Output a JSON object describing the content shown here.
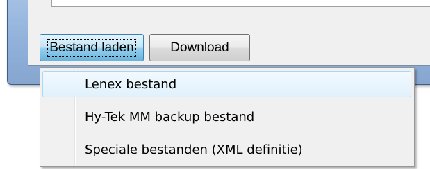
{
  "buttons": {
    "load_label": "Bestand laden",
    "download_label": "Download"
  },
  "menu": {
    "items": [
      {
        "label": "Lenex bestand",
        "highlighted": true
      },
      {
        "label": "Hy-Tek MM backup bestand",
        "highlighted": false
      },
      {
        "label": "Speciale bestanden (XML definitie)",
        "highlighted": false
      }
    ]
  },
  "colors": {
    "window_frame": "#8fb0da",
    "menu_highlight_border": "#a8d8f7",
    "pressed_button_accent": "#68b3db"
  }
}
